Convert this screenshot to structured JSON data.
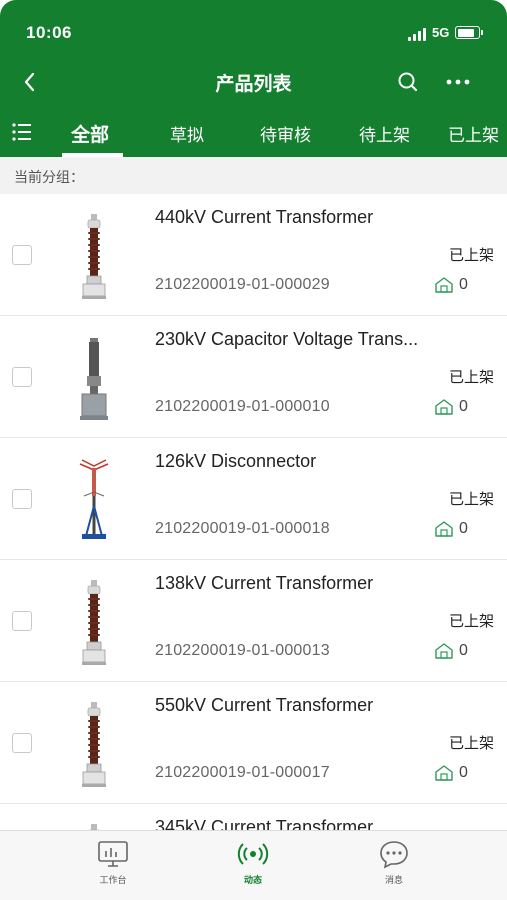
{
  "status_bar": {
    "time": "10:06",
    "network": "5G",
    "battery_level": 0.85
  },
  "nav": {
    "title": "产品列表",
    "back_icon": "chevron-left-icon",
    "search_icon": "search-icon",
    "more_icon": "more-icon"
  },
  "tabs": [
    {
      "label": "全部",
      "active": true
    },
    {
      "label": "草拟",
      "active": false
    },
    {
      "label": "待审核",
      "active": false
    },
    {
      "label": "待上架",
      "active": false
    },
    {
      "label": "已上架",
      "active": false
    }
  ],
  "group": {
    "label": "当前分组："
  },
  "products": [
    {
      "name": "440kV Current Transformer",
      "code": "2102200019-01-000029",
      "status": "已上架",
      "count": "0",
      "image": "current-transformer"
    },
    {
      "name": "230kV Capacitor Voltage Trans...",
      "code": "2102200019-01-000010",
      "status": "已上架",
      "count": "0",
      "image": "capacitor-voltage-transformer"
    },
    {
      "name": "126kV Disconnector",
      "code": "2102200019-01-000018",
      "status": "已上架",
      "count": "0",
      "image": "disconnector"
    },
    {
      "name": "138kV Current Transformer",
      "code": "2102200019-01-000013",
      "status": "已上架",
      "count": "0",
      "image": "current-transformer"
    },
    {
      "name": "550kV Current Transformer",
      "code": "2102200019-01-000017",
      "status": "已上架",
      "count": "0",
      "image": "current-transformer"
    },
    {
      "name": "345kV Current Transformer",
      "code": "",
      "status": "",
      "count": "",
      "image": "current-transformer"
    }
  ],
  "bottom_nav": [
    {
      "label": "工作台",
      "icon": "workbench-icon",
      "active": false
    },
    {
      "label": "动态",
      "icon": "broadcast-icon",
      "active": true
    },
    {
      "label": "消息",
      "icon": "message-icon",
      "active": false
    }
  ],
  "colors": {
    "brand": "#14802f",
    "stock_icon": "#2e9a5a"
  }
}
